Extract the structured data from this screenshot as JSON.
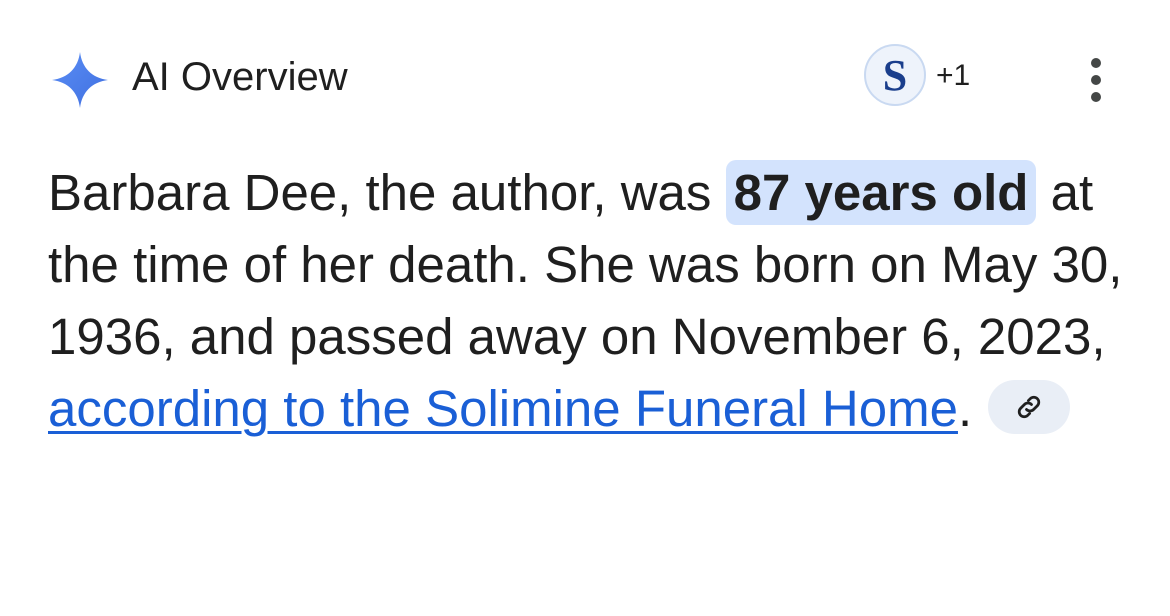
{
  "header": {
    "title": "AI Overview",
    "icon": "sparkle-icon",
    "accent_color": "#4285f4"
  },
  "sources": {
    "avatar_letter": "S",
    "extra_count": "+1"
  },
  "menu": {
    "icon": "more-vert-icon"
  },
  "answer": {
    "text_before": "Barbara Dee, the author, was ",
    "highlight": "87 years old",
    "text_middle": " at the time of her death. She was born on May 30, 1936, and passed away on November 6, 2023, ",
    "link_text": "according to the Solimine Funeral Home",
    "text_after": ".",
    "link_chip_icon": "link-icon",
    "link_color": "#1a5fd6",
    "highlight_color": "#d3e3fd"
  }
}
